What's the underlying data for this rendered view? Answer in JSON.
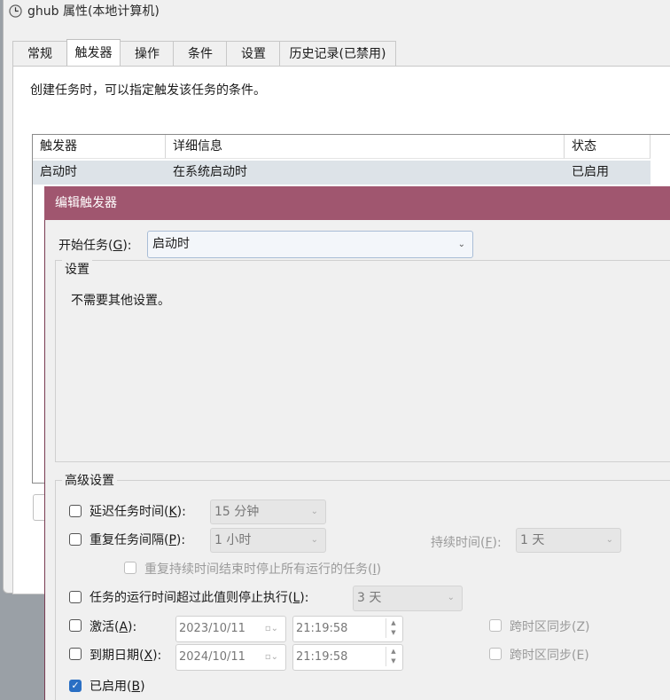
{
  "parent_window": {
    "title": "ghub 属性(本地计算机)",
    "tabs": [
      "常规",
      "触发器",
      "操作",
      "条件",
      "设置",
      "历史记录(已禁用)"
    ],
    "description": "创建任务时，可以指定触发该任务的条件。",
    "table": {
      "headers": [
        "触发器",
        "详细信息",
        "状态"
      ],
      "rows": [
        [
          "启动时",
          "在系统启动时",
          "已启用"
        ]
      ]
    }
  },
  "dialog": {
    "title": "编辑触发器",
    "begin_task": {
      "label": "开始任务(",
      "key": "G",
      "suffix": "):",
      "value": "启动时"
    },
    "settings_group": {
      "title": "设置",
      "text": "不需要其他设置。"
    },
    "advanced": {
      "title": "高级设置",
      "delay": {
        "label": "延迟任务时间(",
        "key": "K",
        "suffix": "):",
        "value": "15 分钟",
        "checked": false
      },
      "repeat": {
        "label": "重复任务间隔(",
        "key": "P",
        "suffix": "):",
        "value": "1 小时",
        "checked": false,
        "duration_label": "持续时间(",
        "duration_key": "F",
        "duration_suffix": "):",
        "duration_value": "1 天"
      },
      "stop_all": {
        "label": "重复持续时间结束时停止所有运行的任务(",
        "key": "I",
        "suffix": ")",
        "checked": false
      },
      "stop_if": {
        "label": "任务的运行时间超过此值则停止执行(",
        "key": "L",
        "suffix": "):",
        "value": "3 天",
        "checked": false
      },
      "activate": {
        "label": "激活(",
        "key": "A",
        "suffix": "):",
        "date": "2023/10/11",
        "time": "21:19:58",
        "checked": false,
        "sync_label": "跨时区同步(Z)"
      },
      "expire": {
        "label": "到期日期(",
        "key": "X",
        "suffix": "):",
        "date": "2024/10/11",
        "time": "21:19:58",
        "checked": false,
        "sync_label": "跨时区同步(E)"
      },
      "enabled": {
        "label": "已启用(",
        "key": "B",
        "suffix": ")",
        "checked": true
      }
    }
  },
  "colors": {
    "dialog_title_bar": "#a0566f",
    "checkbox_on": "#2a6fc4"
  }
}
